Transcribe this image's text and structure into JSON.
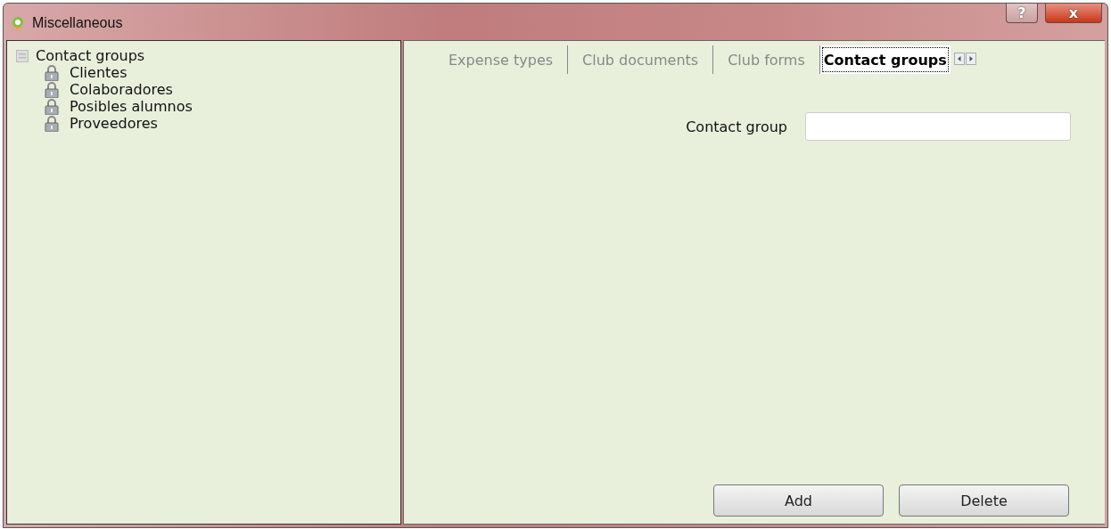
{
  "window": {
    "title": "Miscellaneous",
    "help_button": "?",
    "close_button": "x"
  },
  "tree": {
    "label": "Contact groups",
    "children": [
      {
        "label": "Clientes"
      },
      {
        "label": "Colaboradores"
      },
      {
        "label": "Posibles alumnos"
      },
      {
        "label": "Proveedores"
      }
    ]
  },
  "tabs": [
    {
      "label": "Expense types",
      "selected": false
    },
    {
      "label": "Club documents",
      "selected": false
    },
    {
      "label": "Club forms",
      "selected": false
    },
    {
      "label": "Contact groups",
      "selected": true
    }
  ],
  "form": {
    "label": "Contact group"
  },
  "buttons": [
    "Add",
    "Delete"
  ]
}
